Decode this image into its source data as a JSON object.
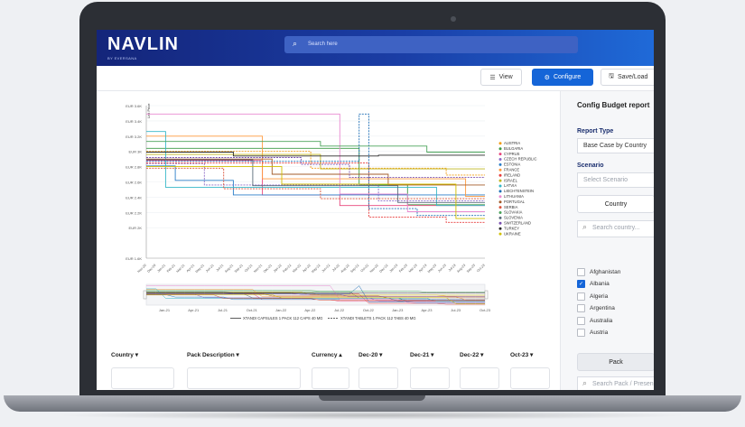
{
  "app": {
    "logo": "NAVLIN",
    "logo_sub": "BY EVERSANA"
  },
  "search": {
    "placeholder": "Search here"
  },
  "toolbar": {
    "view_label": "View",
    "configure_label": "Configure",
    "save_label": "Save/Load"
  },
  "config": {
    "title": "Config Budget report",
    "report_type_label": "Report Type",
    "report_type_value": "Base Case by Country",
    "scenario_label": "Scenario",
    "scenario_placeholder": "Select Scenario",
    "country_button": "Country",
    "country_search_placeholder": "Search country...",
    "countries": [
      {
        "name": "Afghanistan",
        "checked": false
      },
      {
        "name": "Albania",
        "checked": true
      },
      {
        "name": "Algeria",
        "checked": false
      },
      {
        "name": "Argentina",
        "checked": false
      },
      {
        "name": "Australia",
        "checked": false
      },
      {
        "name": "Austria",
        "checked": false
      }
    ],
    "pack_button": "Pack",
    "pack_search_placeholder": "Search Pack / Presen"
  },
  "table": {
    "columns": [
      "Country",
      "Pack Description",
      "Currency",
      "Dec-20",
      "Dec-21",
      "Dec-22",
      "Oct-23"
    ]
  },
  "chart_data": {
    "type": "line",
    "ylabel": "List Price",
    "y_ticks": [
      "EUR 1.6K",
      "EUR 2K",
      "EUR 2.2K",
      "EUR 2.4K",
      "EUR 2.6K",
      "EUR 2.8K",
      "EUR 3K",
      "EUR 3.2K",
      "EUR 3.4K",
      "EUR 3.6K"
    ],
    "ylim": [
      1600,
      3600
    ],
    "x_ticks": [
      "Nov-20",
      "Dec-20",
      "Jan-21",
      "Feb-21",
      "Mar-21",
      "Apr-21",
      "May-21",
      "Jun-21",
      "Jul-21",
      "Aug-21",
      "Sep-21",
      "Oct-21",
      "Nov-21",
      "Dec-21",
      "Jan-22",
      "Feb-22",
      "Mar-22",
      "Apr-22",
      "May-22",
      "Jun-22",
      "Jul-22",
      "Aug-22",
      "Sep-22",
      "Oct-22",
      "Nov-22",
      "Dec-22",
      "Jan-23",
      "Feb-23",
      "Mar-23",
      "Apr-23",
      "May-23",
      "Jun-23",
      "Jul-23",
      "Aug-23",
      "Sep-23",
      "Oct-23"
    ],
    "navigator_ticks": [
      "Jan-21",
      "Apr-21",
      "Jul-21",
      "Oct-21",
      "Jan-22",
      "Apr-22",
      "Jul-22",
      "Oct-22",
      "Jan-23",
      "Apr-23",
      "Jul-23",
      "Oct-23"
    ],
    "pack_legend": [
      {
        "name": "XTANDI CAPSULES 1 PACK 112 CAPS 40 MG",
        "dash": "solid"
      },
      {
        "name": "XTANDI TABLETS 1 PACK 112 TABS 40 MG",
        "dash": "dashed"
      }
    ],
    "series": [
      {
        "name": "AUSTRIA",
        "color": "#f39c12",
        "start": 3000,
        "steps": [
          [
            17,
            2780
          ],
          [
            31,
            2690
          ]
        ]
      },
      {
        "name": "BULGARIA",
        "color": "#3b9a45",
        "start": 3040,
        "steps": [
          [
            22,
            2560
          ],
          [
            27,
            2300
          ]
        ]
      },
      {
        "name": "CYPRUS",
        "color": "#e8457c",
        "start": 2880,
        "steps": [
          [
            12,
            2430
          ],
          [
            20,
            2290
          ]
        ]
      },
      {
        "name": "CZECH REPUBLIC",
        "color": "#8d6cc8",
        "start": 2840,
        "steps": [
          [
            6,
            2560
          ],
          [
            24,
            2350
          ]
        ]
      },
      {
        "name": "ESTONIA",
        "color": "#2b7ec8",
        "start": 2810,
        "steps": [
          [
            3,
            2620
          ],
          [
            9,
            2430
          ]
        ]
      },
      {
        "name": "FRANCE",
        "color": "#ff9a3c",
        "start": 3200,
        "steps": [
          [
            12,
            2640
          ],
          [
            33,
            2410
          ]
        ]
      },
      {
        "name": "IRELAND",
        "color": "#e73c3c",
        "start": 2850,
        "steps": [
          [
            23,
            2140
          ],
          [
            31,
            2070
          ]
        ]
      },
      {
        "name": "ISRAEL",
        "color": "#c0b720",
        "start": 2960,
        "steps": [
          [
            18,
            2770
          ]
        ]
      },
      {
        "name": "LATVIA",
        "color": "#35b7c8",
        "start": 3260,
        "steps": [
          [
            2,
            2530
          ],
          [
            30,
            2290
          ]
        ]
      },
      {
        "name": "LIECHTENSTEIN",
        "color": "#1f6fb5",
        "start": 2870,
        "steps": [
          [
            22,
            3490
          ],
          [
            23,
            2250
          ],
          [
            28,
            2160
          ]
        ]
      },
      {
        "name": "LITHUANIA",
        "color": "#e98ad0",
        "start": 3490,
        "steps": [
          [
            20,
            2440
          ],
          [
            27,
            2210
          ]
        ]
      },
      {
        "name": "PORTUGAL",
        "color": "#a35b2a",
        "start": 2900,
        "steps": [
          [
            13,
            2700
          ],
          [
            25,
            2560
          ]
        ]
      },
      {
        "name": "SERBIA",
        "color": "#d9533a",
        "start": 2780,
        "steps": [
          [
            8,
            2510
          ],
          [
            18,
            2380
          ]
        ]
      },
      {
        "name": "SLOVAKIA",
        "color": "#4aa35a",
        "start": 3130,
        "steps": [
          [
            18,
            3070
          ],
          [
            29,
            2990
          ]
        ]
      },
      {
        "name": "SLOVENIA",
        "color": "#5a6b7a",
        "start": 2890,
        "steps": [
          [
            11,
            2550
          ],
          [
            26,
            2330
          ]
        ]
      },
      {
        "name": "SWITZERLAND",
        "color": "#7a4fb0",
        "start": 2920,
        "steps": [
          [
            16,
            2830
          ],
          [
            21,
            2660
          ]
        ]
      },
      {
        "name": "TURKEY",
        "color": "#2a2a2a",
        "start": 2990,
        "steps": [
          [
            9,
            2940
          ],
          [
            24,
            2950
          ]
        ]
      },
      {
        "name": "UKRAINE",
        "color": "#d1c000",
        "start": 2800,
        "steps": [
          [
            14,
            2570
          ],
          [
            32,
            2120
          ]
        ]
      }
    ]
  }
}
